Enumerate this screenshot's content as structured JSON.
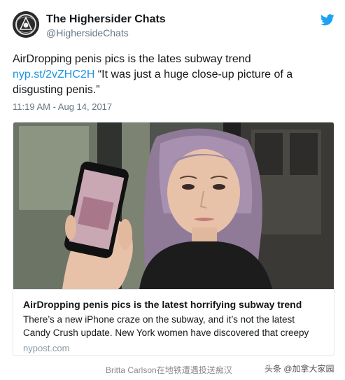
{
  "tweet": {
    "author_name": "The Highersider Chats",
    "author_handle": "@HighersideChats",
    "text_line1": "AirDropping penis pics is the lates subway trend",
    "link": "nyp.st/2vZHC2H",
    "text_after_link": " “It was just a huge close-up picture of a disgusting penis.”",
    "timestamp": "11:19 AM - Aug 14, 2017"
  },
  "card": {
    "title": "AirDropping penis pics is the latest horrifying subway trend",
    "description": "There’s a new iPhone craze on the subway, and it’s not the latest Candy Crush update. New York women have discovered that creepy",
    "domain": "nypost.com"
  },
  "footer": {
    "caption": "Britta Carlson在地铁遭遇投送痴汉",
    "watermark": "头条 @加拿大家园"
  },
  "colors": {
    "link": "#1b95e0",
    "twitter_bird": "#1da1f2",
    "muted": "#657786"
  },
  "icons": [
    "twitter-bird-icon",
    "avatar"
  ]
}
